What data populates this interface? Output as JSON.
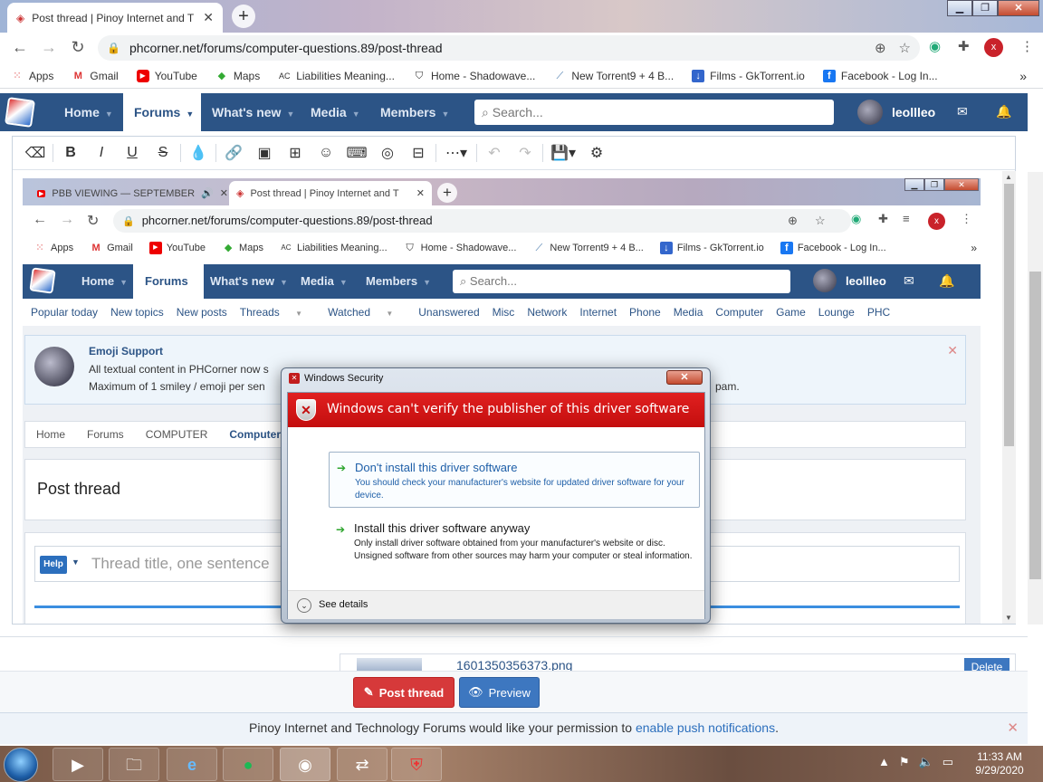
{
  "browser": {
    "tab_title": "Post thread | Pinoy Internet and T",
    "url": "phcorner.net/forums/computer-questions.89/post-thread",
    "profile_initial": "x",
    "bookmarks": [
      "Apps",
      "Gmail",
      "YouTube",
      "Maps",
      "Liabilities Meaning...",
      "Home - Shadowave...",
      "New Torrent9 + 4 B...",
      "Films - GkTorrent.io",
      "Facebook - Log In..."
    ],
    "bookmarks_overflow": "»"
  },
  "site": {
    "nav": [
      "Home",
      "Forums",
      "What's new",
      "Media",
      "Members"
    ],
    "search_placeholder": "Search...",
    "username": "leollleo"
  },
  "embedded": {
    "tabs": [
      "PBB VIEWING — SEPTEMBER",
      "Post thread | Pinoy Internet and T"
    ],
    "url": "phcorner.net/forums/computer-questions.89/post-thread",
    "subnav": [
      "Popular today",
      "New topics",
      "New posts",
      "Threads",
      "Watched",
      "Unanswered",
      "Misc",
      "Network",
      "Internet",
      "Phone",
      "Media",
      "Computer",
      "Game",
      "Lounge",
      "PHC"
    ],
    "notice_title": "Emoji Support",
    "notice_line1": "All textual content in PHCorner now s",
    "notice_line2": "Maximum of 1 smiley / emoji per sen",
    "notice_line2_end": "pam.",
    "breadcrumbs": [
      "Home",
      "Forums",
      "COMPUTER",
      "Computer"
    ],
    "page_title": "Post thread",
    "help_label": "Help",
    "title_placeholder": "Thread title, one sentence"
  },
  "dialog": {
    "caption": "Windows Security",
    "heading": "Windows can't verify the publisher of this driver software",
    "option1_title": "Don't install this driver software",
    "option1_desc": "You should check your manufacturer's website for updated driver software for your device.",
    "option2_title": "Install this driver software anyway",
    "option2_desc": "Only install driver software obtained from your manufacturer's website or disc. Unsigned software from other sources may harm your computer or steal information.",
    "details_label": "See details"
  },
  "attachment": {
    "filename": "1601350356373.png",
    "delete_label": "Delete"
  },
  "actions": {
    "post_label": "Post thread",
    "preview_label": "Preview"
  },
  "push": {
    "text": "Pinoy Internet and Technology Forums would like your permission to",
    "link": "enable push notifications",
    "period": "."
  },
  "taskbar": {
    "time": "11:33 AM",
    "date": "9/29/2020"
  }
}
